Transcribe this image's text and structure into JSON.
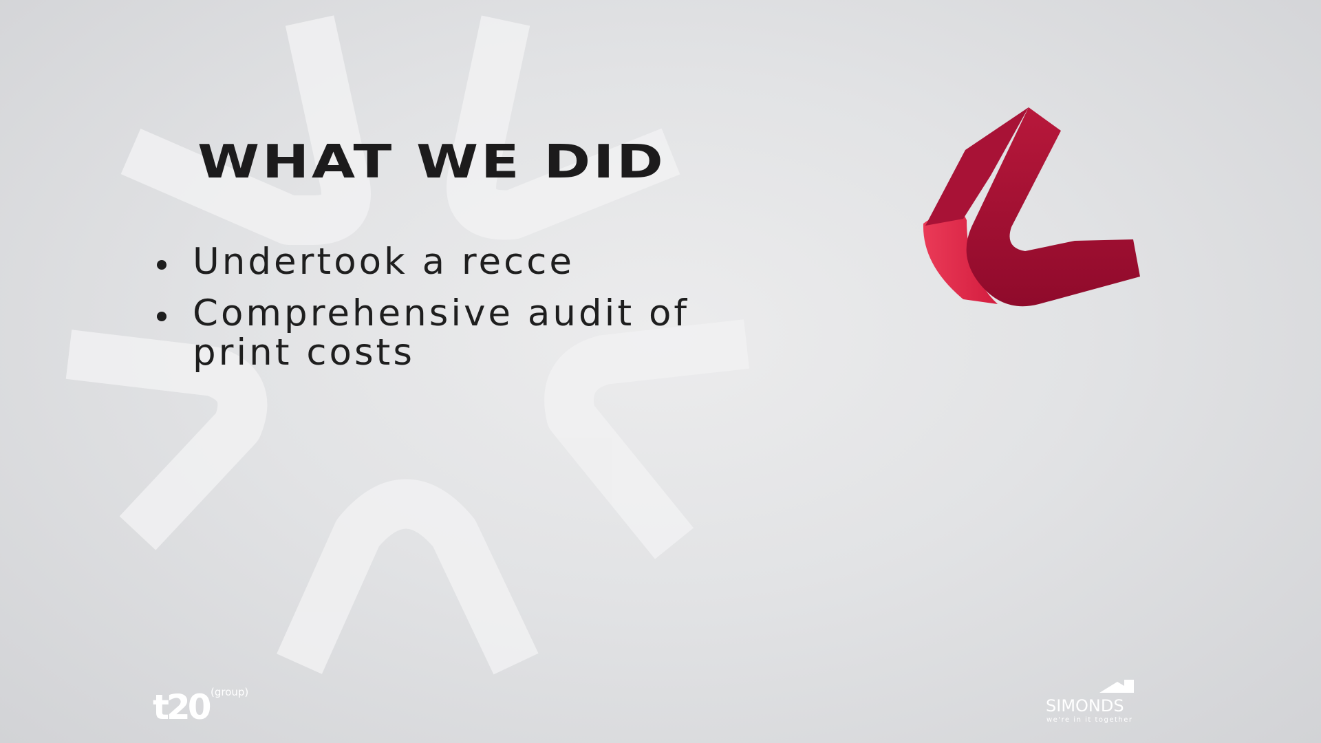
{
  "slide": {
    "title": "WHAT WE DID",
    "bullets": [
      "Undertook a recce",
      "Comprehensive audit of print costs"
    ]
  },
  "logos": {
    "left": {
      "name": "t20-logo",
      "wordmark": "t20",
      "superscript": "(group)"
    },
    "right": {
      "name": "simonds-logo",
      "wordmark": "SIMONDS",
      "tagline": "we're in it together"
    }
  },
  "colors": {
    "background": "#e2e3e5",
    "text": "#1c1b1c",
    "star_shape": "#f0f0f1",
    "accent_dark": "#9b0e30",
    "accent_light": "#e7324f",
    "logo": "#ffffff"
  },
  "icons": [
    "starburst-background",
    "checkmark-icon",
    "house-roof-icon"
  ]
}
